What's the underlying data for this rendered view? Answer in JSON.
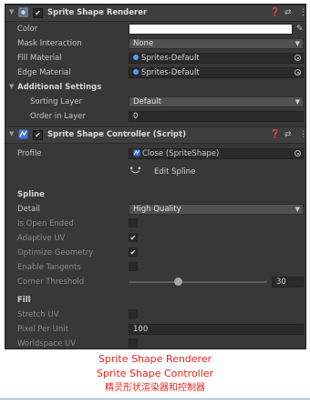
{
  "renderer": {
    "title": "Sprite Shape Renderer",
    "enabled": true,
    "color_label": "Color",
    "color_value": "#ffffff",
    "mask_label": "Mask Interaction",
    "mask_value": "None",
    "fill_material_label": "Fill Material",
    "fill_material_value": "Sprites-Default",
    "edge_material_label": "Edge Material",
    "edge_material_value": "Sprites-Default",
    "additional_label": "Additional Settings",
    "sorting_layer_label": "Sorting Layer",
    "sorting_layer_value": "Default",
    "order_label": "Order in Layer",
    "order_value": "0"
  },
  "controller": {
    "title": "Sprite Shape Controller (Script)",
    "enabled": true,
    "profile_label": "Profile",
    "profile_value": "Close (SpriteShape)",
    "edit_spline_label": "Edit Spline",
    "spline_section": "Spline",
    "detail_label": "Detail",
    "detail_value": "High Quality",
    "open_ended_label": "Is Open Ended",
    "open_ended": false,
    "adaptive_label": "Adaptive UV",
    "adaptive": true,
    "optimize_label": "Optimize Geometry",
    "optimize": true,
    "tangents_label": "Enable Tangents",
    "tangents": false,
    "corner_label": "Corner Threshold",
    "corner_value": "30",
    "fill_section": "Fill",
    "stretch_label": "Stretch UV",
    "stretch": false,
    "ppu_label": "Pixel Per Unit",
    "ppu_value": "100",
    "worldspace_label": "Worldspace UV",
    "worldspace": false
  },
  "header_icons": [
    "help-icon",
    "preset-icon",
    "context-menu-icon"
  ],
  "caption": {
    "line1": "Sprite Shape Renderer",
    "line2": "Sprite Shape Controller",
    "line3": "精灵形状渲染器和控制器",
    "color": "#e8221b"
  }
}
